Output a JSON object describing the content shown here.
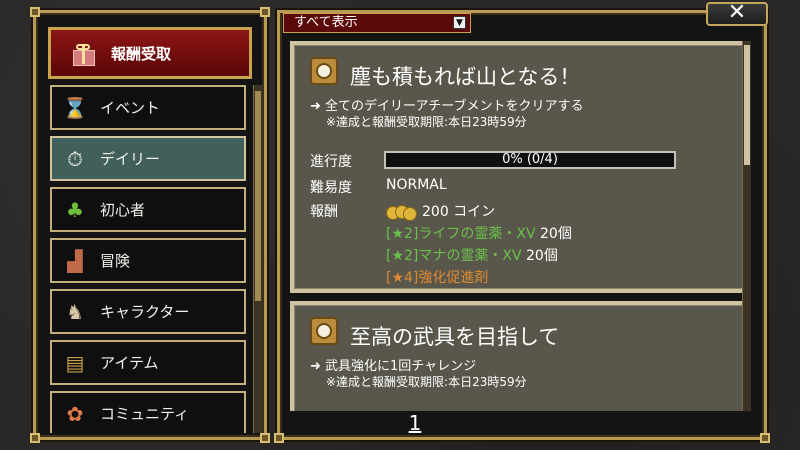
{
  "header": {
    "filter_label": "すべて表示",
    "close_label": "✕"
  },
  "sidebar": {
    "reward_button": "報酬受取",
    "items": [
      {
        "label": "イベント",
        "icon": "hourglass-icon"
      },
      {
        "label": "デイリー",
        "icon": "stopwatch-icon"
      },
      {
        "label": "初心者",
        "icon": "sprout-icon"
      },
      {
        "label": "冒険",
        "icon": "boot-icon"
      },
      {
        "label": "キャラクター",
        "icon": "character-icon"
      },
      {
        "label": "アイテム",
        "icon": "item-bag-icon"
      },
      {
        "label": "コミュニティ",
        "icon": "handshake-icon"
      }
    ],
    "active_index": 1
  },
  "achievements": [
    {
      "title": "塵も積もれば山となる！",
      "description": "➜ 全てのデイリーアチーブメントをクリアする",
      "deadline": "※達成と報酬受取期限:本日23時59分",
      "progress_label": "進行度",
      "progress_text": "0% (0/4)",
      "progress_value": 0,
      "difficulty_label": "難易度",
      "difficulty": "NORMAL",
      "reward_label": "報酬",
      "rewards": [
        {
          "text": "200 コイン"
        },
        {
          "prefix": "[★2]ライフの霊薬・XV",
          "qty": "20個"
        },
        {
          "prefix": "[★2]マナの霊薬・XV",
          "qty": "20個"
        },
        {
          "prefix": "[★4]強化促進剤"
        }
      ]
    },
    {
      "title": "至高の武具を目指して",
      "description": "➜ 武具強化に1回チャレンジ",
      "deadline": "※達成と報酬受取期限:本日23時59分"
    }
  ],
  "pagination": {
    "current": "1"
  },
  "colors": {
    "accent_gold": "#c9a24c",
    "active_tab": "#41605b",
    "reward_red": "#8d1616",
    "item_green": "#6ac04a",
    "item_orange": "#e08a32"
  }
}
